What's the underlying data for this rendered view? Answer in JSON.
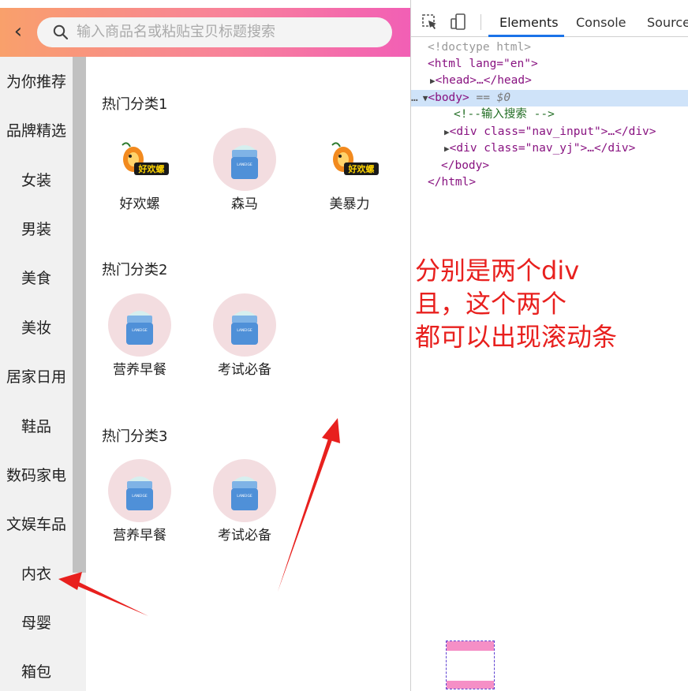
{
  "search": {
    "placeholder": "输入商品名或粘贴宝贝标题搜索"
  },
  "sidebar": {
    "items": [
      {
        "label": "为你推荐"
      },
      {
        "label": "品牌精选"
      },
      {
        "label": "女装"
      },
      {
        "label": "男装"
      },
      {
        "label": "美食"
      },
      {
        "label": "美妆"
      },
      {
        "label": "居家日用"
      },
      {
        "label": "鞋品"
      },
      {
        "label": "数码家电"
      },
      {
        "label": "文娱车品"
      },
      {
        "label": "内衣"
      },
      {
        "label": "母婴"
      },
      {
        "label": "箱包"
      }
    ]
  },
  "categories": [
    {
      "title": "热门分类1",
      "products": [
        {
          "name": "好欢螺",
          "image": "haohuanluo-logo"
        },
        {
          "name": "森马",
          "image": "cream-jar"
        },
        {
          "name": "美暴力",
          "image": "haohuanluo-logo"
        }
      ]
    },
    {
      "title": "热门分类2",
      "products": [
        {
          "name": "营养早餐",
          "image": "cream-jar"
        },
        {
          "name": "考试必备",
          "image": "cream-jar"
        }
      ]
    },
    {
      "title": "热门分类3",
      "products": [
        {
          "name": "营养早餐",
          "image": "cream-jar"
        },
        {
          "name": "考试必备",
          "image": "cream-jar"
        }
      ]
    }
  ],
  "logo_text": "好欢螺",
  "jar_brand": "LANEIGE",
  "devtools": {
    "tabs": [
      "Elements",
      "Console",
      "Sources"
    ],
    "active_tab": "Elements",
    "dom": {
      "doctype": "<!doctype html>",
      "html_open": "<html lang=\"en\">",
      "head": "<head>…</head>",
      "body_open": "<body>",
      "body_marker": "== $0",
      "comment": "<!--输入搜索 -->",
      "div1": "<div class=\"nav_input\">…</div>",
      "div2": "<div class=\"nav_yj\">…</div>",
      "body_close": "</body>",
      "html_close": "</html>"
    }
  },
  "annotation": {
    "lines": [
      "分别是两个div",
      "且，这个两个",
      "都可以出现滚动条"
    ],
    "color": "#e8201e"
  },
  "colors": {
    "navbar_gradient": [
      "#f9a06b",
      "#f8829a",
      "#f25fb5"
    ],
    "devtools_active": "#1a73e8"
  }
}
